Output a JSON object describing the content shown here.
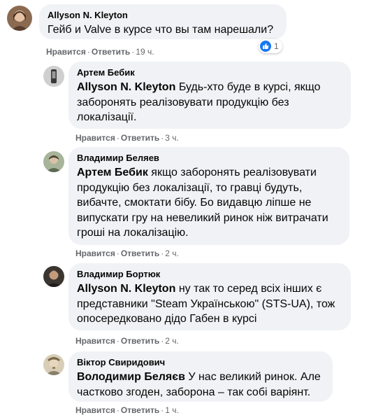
{
  "comments": [
    {
      "author": "Allyson N. Kleyton",
      "mention": "",
      "text": "Гейб и Valve в курсе что вы там нарешали?",
      "like_label": "Нравится",
      "reply_label": "Ответить",
      "time": "19 ч.",
      "reaction_count": "1"
    },
    {
      "author": "Артем Бебик",
      "mention": "Allyson N. Kleyton",
      "text": "Будь-хто буде в курсі, якщо заборонять реалізовувати продукцію без локалізації.",
      "like_label": "Нравится",
      "reply_label": "Ответить",
      "time": "3 ч."
    },
    {
      "author": "Владимир Беляев",
      "mention": "Артем Бебик",
      "text": "якщо заборонять реалізовувати продукцію без локалізації, то гравці будуть, вибачте, смоктати бібу. Бо видавцю ліпше не випускати гру на невеликий ринок ніж витрачати гроші на локалізацію.",
      "like_label": "Нравится",
      "reply_label": "Ответить",
      "time": "2 ч."
    },
    {
      "author": "Владимир Бортюк",
      "mention": "Allyson N. Kleyton",
      "text": "ну так то серед всіх інших є представники \"Steam Українською\" (STS-UA), тож опосередковано дідо Габен в курсі",
      "like_label": "Нравится",
      "reply_label": "Ответить",
      "time": "2 ч."
    },
    {
      "author": "Віктор Свиридович",
      "mention": "Володимир Беляєв",
      "text": "У нас великий ринок. Але частково згоден, заборона – так собі варіянт.",
      "like_label": "Нравится",
      "reply_label": "Ответить",
      "time": "1 ч."
    }
  ],
  "colors": {
    "bubble": "#f0f2f5",
    "meta_text": "#65676b",
    "like_blue": "#1877f2"
  }
}
